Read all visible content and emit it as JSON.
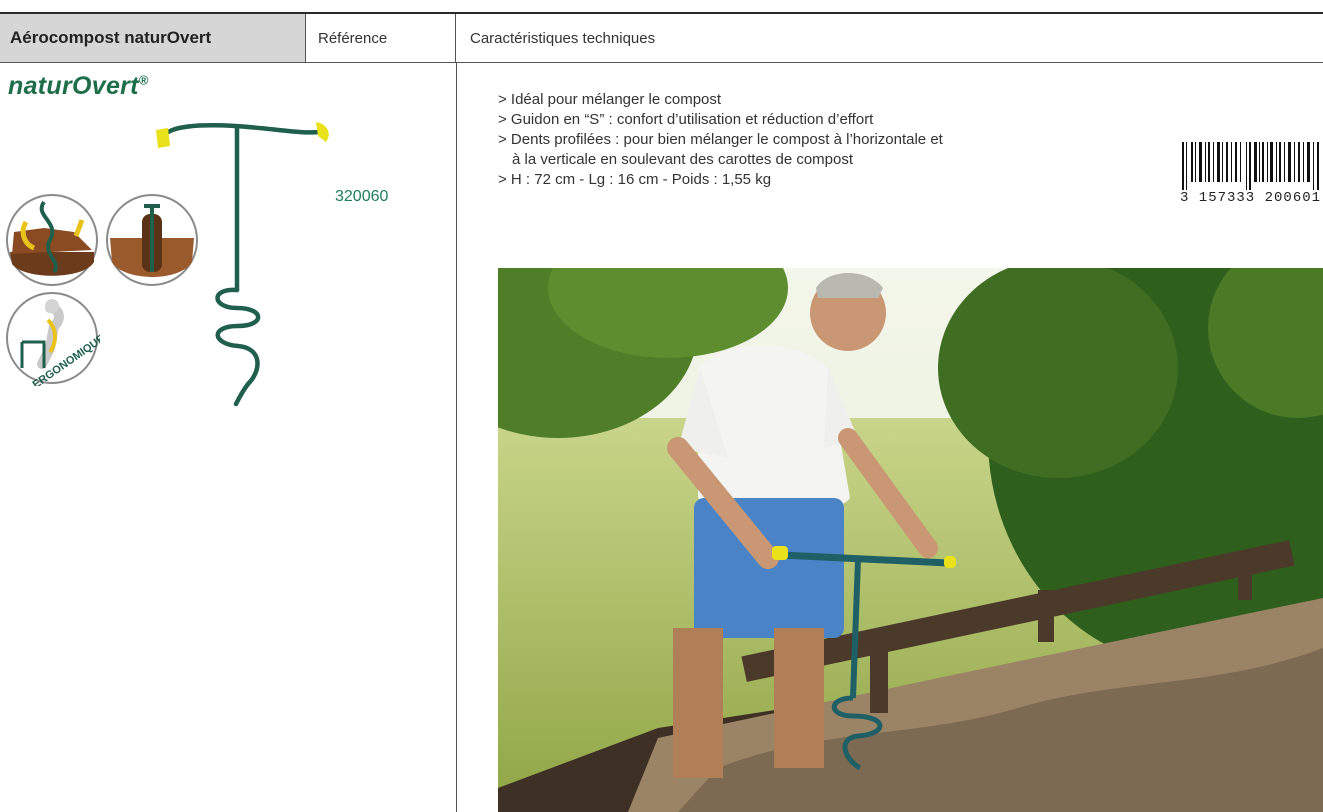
{
  "header": {
    "product_name": "Aérocompost naturOvert",
    "reference_label": "Référence",
    "tech_label": "Caractéristiques techniques"
  },
  "brand": {
    "name": "naturOvert",
    "mark": "®"
  },
  "product": {
    "reference": "320060"
  },
  "badges": {
    "ergonomic_label": "ERGONOMIQUE"
  },
  "features": [
    "> Idéal pour mélanger le compost",
    "> Guidon en “S” : confort d’utilisation et réduction d’effort",
    "> Dents profilées : pour bien mélanger le compost à l’horizontale et",
    "   à la verticale en soulevant des carottes de compost",
    "> H : 72 cm - Lg : 16 cm - Poids : 1,55 kg"
  ],
  "barcode": {
    "digits": "3 157333 200601"
  },
  "colors": {
    "brand_green": "#1e6e4a",
    "tool_green": "#1f5f4c",
    "grip_yellow": "#e9e21a",
    "header_gray": "#d6d6d6"
  }
}
